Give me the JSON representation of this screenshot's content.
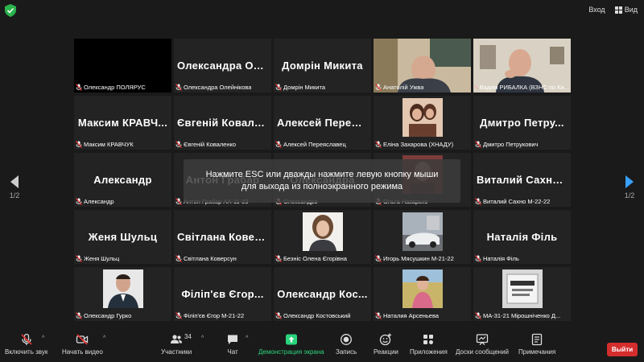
{
  "top": {
    "enter_label": "Вход",
    "view_label": "Вид"
  },
  "overlay": {
    "line1": "Нажмите ESC или дважды нажмите левую кнопку мыши",
    "line2": "для выхода из полноэкранного режима"
  },
  "nav": {
    "left_page": "1/2",
    "right_page": "1/2"
  },
  "tiles": [
    {
      "name": "",
      "label": "Олександр ПОЛЯРУС"
    },
    {
      "name": "Олександра Ол...",
      "label": "Олександра Олейнікова"
    },
    {
      "name": "Домрін Микита",
      "label": "Домрін Микита"
    },
    {
      "name": "",
      "label": "Анатолій Ужва"
    },
    {
      "name": "",
      "label": "Вадим РИБАЛКА (ВЗНС по Ки..."
    },
    {
      "name": "Максим КРАВЧ...",
      "label": "Максим КРАВЧУК"
    },
    {
      "name": "Євгеній Ковале...",
      "label": "Євгеній Коваленко"
    },
    {
      "name": "Алексей Переяс...",
      "label": "Алексей Переяславец"
    },
    {
      "name": "",
      "label": "Еліна Захарова (ХНАДУ)"
    },
    {
      "name": "Дмитро Петру...",
      "label": "Дмитро Петрукович"
    },
    {
      "name": "Александр",
      "label": "Александр"
    },
    {
      "name": "Антон Грабар",
      "label": "Антон Грабар АА-11-23"
    },
    {
      "name": "Олександра",
      "label": "Олександра"
    },
    {
      "name": "",
      "label": "Ольга Назарько"
    },
    {
      "name": "Виталий Сахно...",
      "label": "Виталий Сахно М-22-22"
    },
    {
      "name": "Женя Шульц",
      "label": "Женя Шульц"
    },
    {
      "name": "Світлана Ковер...",
      "label": "Світлана Коверсун"
    },
    {
      "name": "",
      "label": "Безніс Олена Єгорівна"
    },
    {
      "name": "",
      "label": "Игорь Мясушкин М-21-22"
    },
    {
      "name": "Наталія Філь",
      "label": "Наталія Філь"
    },
    {
      "name": "",
      "label": "Олександр Гурко"
    },
    {
      "name": "Філіп'єв Єгор...",
      "label": "Філіп'єв Єгор М-21-22"
    },
    {
      "name": "Олександр Кос...",
      "label": "Олександр Костовський"
    },
    {
      "name": "",
      "label": "Наталия Арсеньева"
    },
    {
      "name": "",
      "label": "МА-31-21 Мірошніченко Д..."
    }
  ],
  "toolbar": {
    "unmute": "Включить звук",
    "start_video": "Начать видео",
    "participants": "Участники",
    "participants_count": "34",
    "chat": "Чат",
    "share": "Демонстрация экрана",
    "record": "Запись",
    "reactions": "Реакции",
    "apps": "Приложения",
    "whiteboards": "Доски сообщений",
    "notes": "Примечания",
    "leave": "Выйти"
  },
  "colors": {
    "share_green": "#2bd47c",
    "leave_red": "#d42d2d",
    "speaker_outline": "#c7e02a",
    "nav_blue": "#39a0ff"
  }
}
